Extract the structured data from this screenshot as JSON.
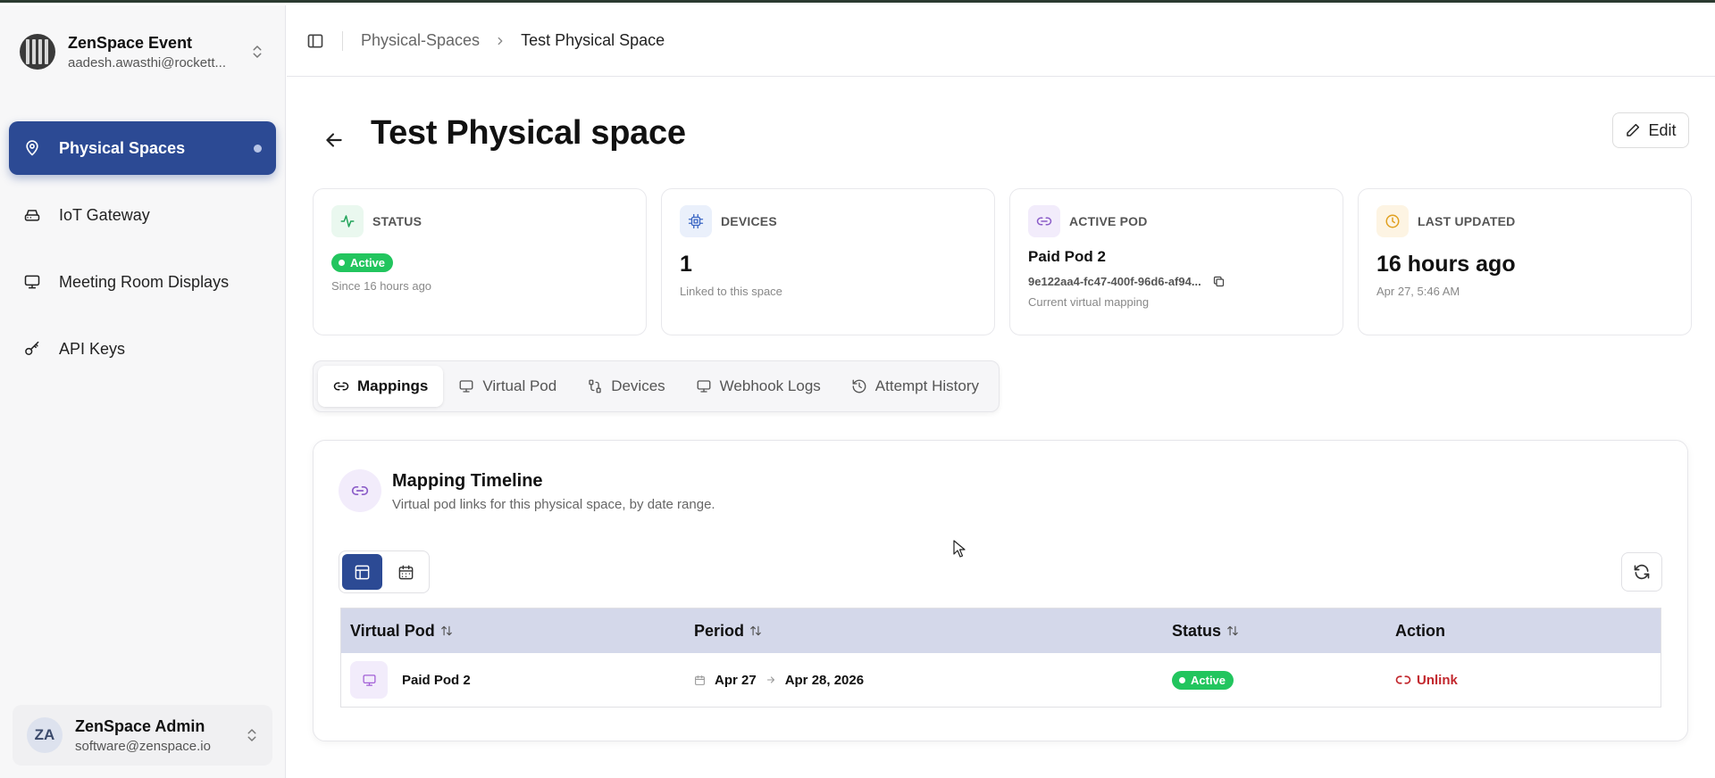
{
  "org": {
    "name": "ZenSpace Event",
    "email": "aadesh.awasthi@rockett..."
  },
  "sidebar": {
    "items": [
      {
        "label": "Physical Spaces",
        "icon": "map-pin-icon"
      },
      {
        "label": "IoT Gateway",
        "icon": "router-icon"
      },
      {
        "label": "Meeting Room Displays",
        "icon": "monitor-icon"
      },
      {
        "label": "API Keys",
        "icon": "key-icon"
      }
    ]
  },
  "user": {
    "initials": "ZA",
    "name": "ZenSpace Admin",
    "email": "software@zenspace.io"
  },
  "breadcrumb": {
    "parent": "Physical-Spaces",
    "current": "Test Physical Space"
  },
  "page": {
    "title": "Test Physical space",
    "edit_label": "Edit"
  },
  "stats": {
    "status": {
      "label": "STATUS",
      "badge": "Active",
      "sub": "Since 16 hours ago"
    },
    "devices": {
      "label": "DEVICES",
      "value": "1",
      "sub": "Linked to this space"
    },
    "active_pod": {
      "label": "ACTIVE POD",
      "name": "Paid Pod 2",
      "id": "9e122aa4-fc47-400f-96d6-af94...",
      "sub": "Current virtual mapping"
    },
    "last_updated": {
      "label": "LAST UPDATED",
      "value": "16 hours ago",
      "sub": "Apr 27, 5:46 AM"
    }
  },
  "tabs": [
    {
      "label": "Mappings",
      "active": true
    },
    {
      "label": "Virtual Pod"
    },
    {
      "label": "Devices"
    },
    {
      "label": "Webhook Logs"
    },
    {
      "label": "Attempt History"
    }
  ],
  "panel": {
    "title": "Mapping Timeline",
    "subtitle": "Virtual pod links for this physical space, by date range."
  },
  "table": {
    "headers": [
      "Virtual Pod",
      "Period",
      "Status",
      "Action"
    ],
    "rows": [
      {
        "pod": "Paid Pod 2",
        "start": "Apr 27",
        "end": "Apr 28, 2026",
        "status": "Active",
        "action": "Unlink"
      }
    ]
  },
  "colors": {
    "accent": "#2c4a94",
    "active_green": "#22c55e",
    "danger": "#c2272d",
    "table_header": "#d4d8ea"
  }
}
